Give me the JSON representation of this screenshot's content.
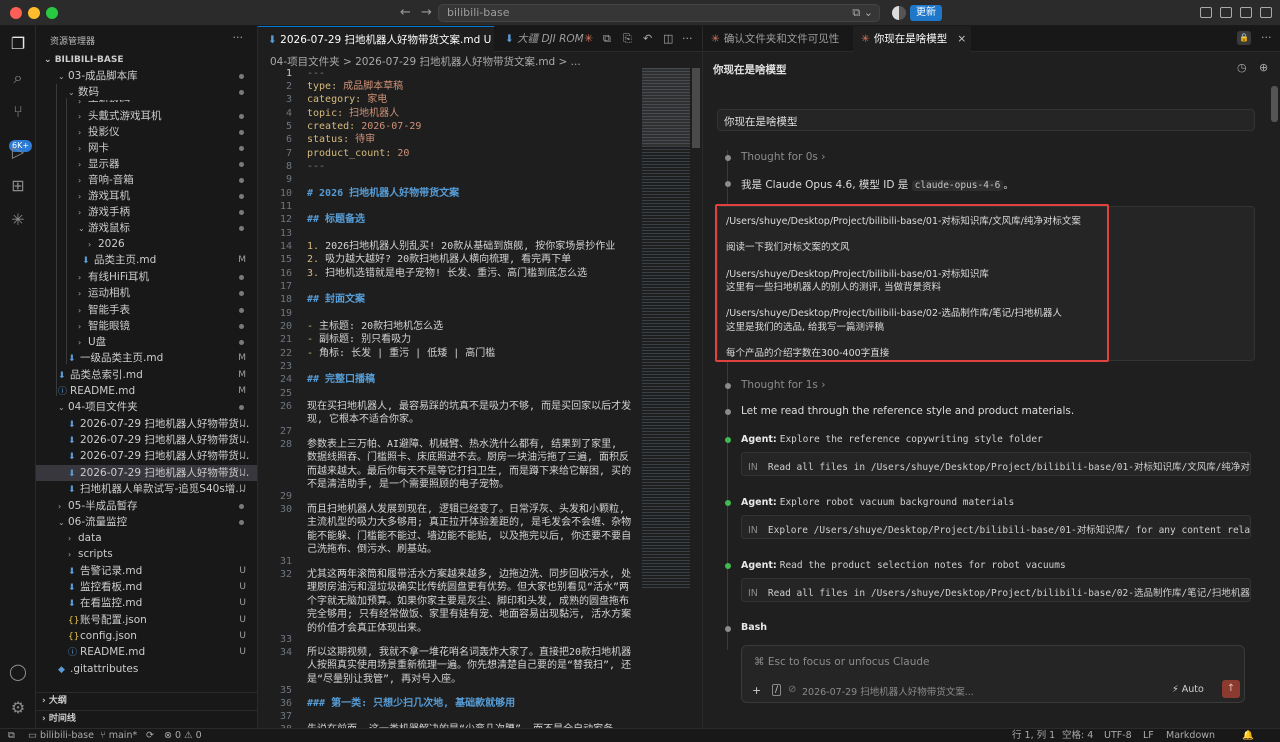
{
  "titlebar": {
    "search_text": "bilibili-base",
    "update_label": "更新"
  },
  "activitybar": {
    "badge": "6K+"
  },
  "sidebar": {
    "title": "资源管理器",
    "root": "BILIBILI-BASE",
    "items": [
      {
        "label": "03-成品脚本库",
        "kind": "folder-open",
        "status": "dot"
      },
      {
        "label": "数码",
        "kind": "folder-open",
        "status": "dot"
      },
      {
        "label": "手机数码",
        "kind": "folder",
        "status": ""
      },
      {
        "label": "头戴式游戏耳机",
        "kind": "folder",
        "status": "dot"
      },
      {
        "label": "投影仪",
        "kind": "folder",
        "status": "dot"
      },
      {
        "label": "网卡",
        "kind": "folder",
        "status": "dot"
      },
      {
        "label": "显示器",
        "kind": "folder",
        "status": "dot"
      },
      {
        "label": "音响-音箱",
        "kind": "folder",
        "status": "dot"
      },
      {
        "label": "游戏耳机",
        "kind": "folder",
        "status": "dot"
      },
      {
        "label": "游戏手柄",
        "kind": "folder",
        "status": "dot"
      },
      {
        "label": "游戏鼠标",
        "kind": "folder-open",
        "status": "dot"
      },
      {
        "label": "2026",
        "kind": "folder",
        "status": ""
      },
      {
        "label": "品类主页.md",
        "kind": "md",
        "status": "M"
      },
      {
        "label": "有线HiFi耳机",
        "kind": "folder",
        "status": "dot"
      },
      {
        "label": "运动相机",
        "kind": "folder",
        "status": "dot"
      },
      {
        "label": "智能手表",
        "kind": "folder",
        "status": "dot"
      },
      {
        "label": "智能眼镜",
        "kind": "folder",
        "status": "dot"
      },
      {
        "label": "U盘",
        "kind": "folder",
        "status": "dot"
      },
      {
        "label": "一级品类主页.md",
        "kind": "md",
        "status": "M"
      },
      {
        "label": "品类总索引.md",
        "kind": "md",
        "status": "M"
      },
      {
        "label": "README.md",
        "kind": "info",
        "status": "M"
      },
      {
        "label": "04-项目文件夹",
        "kind": "folder-open",
        "status": "dot"
      },
      {
        "label": "2026-07-29 扫地机器人好物带货文...",
        "kind": "md",
        "status": "U"
      },
      {
        "label": "2026-07-29 扫地机器人好物带货文...",
        "kind": "md",
        "status": "U"
      },
      {
        "label": "2026-07-29 扫地机器人好物带货文...",
        "kind": "md",
        "status": "U"
      },
      {
        "label": "2026-07-29 扫地机器人好物带货文...",
        "kind": "md",
        "status": "U"
      },
      {
        "label": "扫地机器人单款试写-追觅S40s增强版...",
        "kind": "md",
        "status": "U"
      },
      {
        "label": "05-半成品暂存",
        "kind": "folder",
        "status": "dot"
      },
      {
        "label": "06-流量监控",
        "kind": "folder-open",
        "status": "dot"
      },
      {
        "label": "data",
        "kind": "folder",
        "status": ""
      },
      {
        "label": "scripts",
        "kind": "folder",
        "status": ""
      },
      {
        "label": "告警记录.md",
        "kind": "md",
        "status": "U"
      },
      {
        "label": "监控看板.md",
        "kind": "md",
        "status": "U"
      },
      {
        "label": "在看监控.md",
        "kind": "md",
        "status": "U"
      },
      {
        "label": "账号配置.json",
        "kind": "json",
        "status": "U"
      },
      {
        "label": "config.json",
        "kind": "json",
        "status": "U"
      },
      {
        "label": "README.md",
        "kind": "info",
        "status": "U"
      },
      {
        "label": ".gitattributes",
        "kind": "git",
        "status": ""
      }
    ],
    "outline": "大纲",
    "timeline": "时间线"
  },
  "editor": {
    "tab1": "2026-07-29 扫地机器人好物带货文案.md U",
    "tab2": "大疆 DJI ROM",
    "breadcrumb": "04-项目文件夹 > 2026-07-29 扫地机器人好物带货文案.md > ...",
    "lines": [
      {
        "n": "1",
        "text": "---"
      },
      {
        "n": "2",
        "key": "type: ",
        "val": "成品脚本草稿"
      },
      {
        "n": "3",
        "key": "category: ",
        "val": "家电"
      },
      {
        "n": "4",
        "key": "topic: ",
        "val": "扫地机器人"
      },
      {
        "n": "5",
        "key": "created: ",
        "val": "2026-07-29"
      },
      {
        "n": "6",
        "key": "status: ",
        "val": "待审"
      },
      {
        "n": "7",
        "key": "product_count: ",
        "val": "20"
      },
      {
        "n": "8",
        "text": "---"
      },
      {
        "n": "9",
        "text": ""
      },
      {
        "n": "10",
        "head": "# 2026 扫地机器人好物带货文案"
      },
      {
        "n": "11",
        "text": ""
      },
      {
        "n": "12",
        "head": "## 标题备选"
      },
      {
        "n": "13",
        "text": ""
      },
      {
        "n": "14",
        "num": "1. ",
        "text": "2026扫地机器人别乱买! 20款从基础到旗舰, 按你家场景抄作业"
      },
      {
        "n": "15",
        "num": "2. ",
        "text": "吸力越大越好? 20款扫地机器人横向梳理, 看完再下单"
      },
      {
        "n": "16",
        "num": "3. ",
        "text": "扫地机选错就是电子宠物! 长发、重污、高门槛到底怎么选"
      },
      {
        "n": "17",
        "text": ""
      },
      {
        "n": "18",
        "head": "## 封面文案"
      },
      {
        "n": "19",
        "text": ""
      },
      {
        "n": "20",
        "num": "- ",
        "text": "主标题: 20款扫地机怎么选"
      },
      {
        "n": "21",
        "num": "- ",
        "text": "副标题: 别只看吸力"
      },
      {
        "n": "22",
        "num": "- ",
        "text": "角标: 长发 | 重污 | 低矮 | 高门槛"
      },
      {
        "n": "23",
        "text": ""
      },
      {
        "n": "24",
        "head": "## 完整口播稿"
      },
      {
        "n": "25",
        "text": ""
      },
      {
        "n": "26",
        "text": "现在买扫地机器人, 最容易踩的坑真不是吸力不够, 而是买回家以后才发现, 它根本不适合你家。"
      },
      {
        "n": "27",
        "text": ""
      },
      {
        "n": "28",
        "text": "参数表上三万帕、AI避障、机械臂、热水洗什么都有, 结果到了家里, 数据线照吞、门槛照卡、床底照进不去。厨房一块油污拖了三遍, 面积反而越来越大。最后你每天不是等它打扫卫生, 而是蹲下来给它解困, 买的不是清洁助手, 是一个需要照顾的电子宠物。"
      },
      {
        "n": "29",
        "text": ""
      },
      {
        "n": "30",
        "text": "而且扫地机器人发展到现在, 逻辑已经变了。日常浮灰、头发和小颗粒, 主流机型的吸力大多够用; 真正拉开体验差距的, 是毛发会不会缠、杂物能不能躲、门槛能不能过、墙边能不能贴, 以及拖完以后, 你还要不要自己洗拖布、倒污水、刷基站。"
      },
      {
        "n": "31",
        "text": ""
      },
      {
        "n": "32",
        "text": "尤其这两年滚筒和履带活水方案越来越多, 边拖边洗、同步回收污水, 处理厨房油污和湿垃圾确实比传统圆盘更有优势。但大家也别看见“活水”两个字就无脑加预算。如果你家主要是灰尘、脚印和头发, 成熟的圆盘拖布完全够用; 只有经常做饭、家里有娃有宠、地面容易出现黏污, 活水方案的价值才会真正体现出来。"
      },
      {
        "n": "33",
        "text": ""
      },
      {
        "n": "34",
        "text": "所以这期视频, 我就不拿一堆花哨名词轰炸大家了。直接把20款扫地机器人按照真实使用场景重新梳理一遍。你先想清楚自己要的是“替我扫”, 还是“尽量别让我管”, 再对号入座。"
      },
      {
        "n": "35",
        "text": ""
      },
      {
        "n": "36",
        "head": "### 第一类: 只想少扫几次地, 基础款就够用"
      },
      {
        "n": "37",
        "text": ""
      },
      {
        "n": "38",
        "text": "先说在前面, 这一类机器解决的是“少弯几次腰”, 而不是全自动家务。它们大多只有"
      }
    ]
  },
  "chat": {
    "tab1": "确认文件夹和文件可见性",
    "tab2": "你现在是啥模型",
    "title": "你现在是啥模型",
    "user_msg1": "你现在是啥模型",
    "thought1": "Thought for 0s",
    "reply_prefix": "我是 Claude Opus 4.6, 模型 ID 是",
    "reply_code": "claude-opus-4-6",
    "reply_suffix": "。",
    "user_msg2_lines": [
      "/Users/shuye/Desktop/Project/bilibili-base/01-对标知识库/文风库/纯净对标文案",
      "",
      "阅读一下我们对标文案的文风",
      "",
      "/Users/shuye/Desktop/Project/bilibili-base/01-对标知识库",
      "这里有一些扫地机器人的别人的测评, 当做背景资料",
      "",
      "/Users/shuye/Desktop/Project/bilibili-base/02-选品制作库/笔记/扫地机器人",
      "这里是我们的选品, 给我写一篇测评稿",
      "",
      "每个产品的介绍字数在300-400字直接"
    ],
    "thought2": "Thought for 1s",
    "reply2": "Let me read through the reference style and product materials.",
    "agents": [
      {
        "label": "Agent:",
        "desc": "Explore the reference copywriting style folder",
        "io": "IN",
        "cmd": "Read all files in /Users/shuye/Desktop/Project/bilibili-base/01-对标知识库/文风库/纯净对标文案/ directo"
      },
      {
        "label": "Agent:",
        "desc": "Explore robot vacuum background materials",
        "io": "IN",
        "cmd": "Explore /Users/shuye/Desktop/Project/bilibili-base/01-对标知识库/ for any content related to 扫地机器"
      },
      {
        "label": "Agent:",
        "desc": "Read the product selection notes for robot vacuums",
        "io": "IN",
        "cmd": "Read all files in /Users/shuye/Desktop/Project/bilibili-base/02-选品制作库/笔记/扫地机器人/ directory."
      }
    ],
    "bash_label": "Bash",
    "input_placeholder": "⌘ Esc to focus or unfocus Claude",
    "input_file": "2026-07-29 扫地机器人好物带货文案...",
    "input_mode": "Auto"
  },
  "statusbar": {
    "repo": "bilibili-base",
    "branch": "main*",
    "problems": "⊗ 0 ⚠ 0",
    "position": "行 1, 列 1",
    "spaces": "空格: 4",
    "encoding": "UTF-8",
    "eol": "LF",
    "language": "Markdown"
  }
}
